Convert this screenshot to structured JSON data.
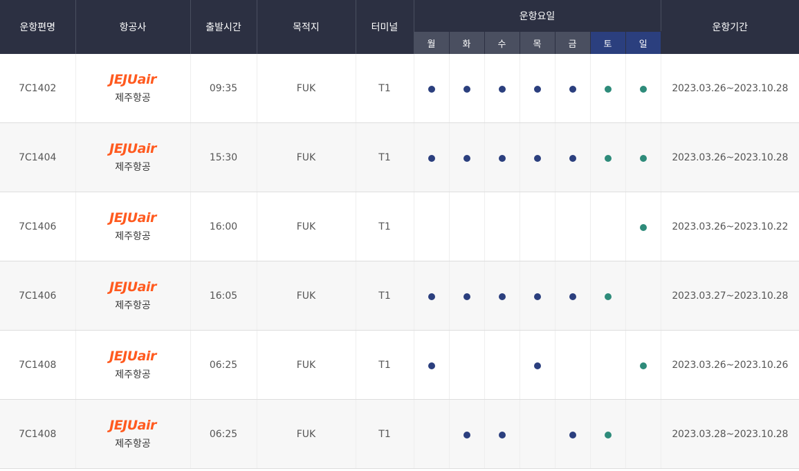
{
  "headers": {
    "flight_no": "운항편명",
    "airline": "항공사",
    "departure": "출발시간",
    "destination": "목적지",
    "terminal": "터미널",
    "days_group": "운항요일",
    "period": "운항기간"
  },
  "days": [
    "월",
    "화",
    "수",
    "목",
    "금",
    "토",
    "일"
  ],
  "colors": {
    "header_bg": "#2c3042",
    "weekday_header_bg": "#4a4f60",
    "weekend_header_bg": "#2b3f7e",
    "weekday_dot": "#2b3f7e",
    "weekend_dot": "#2e8b7a",
    "logo": "#ff5a1f"
  },
  "rows": [
    {
      "flight_no": "7C1402",
      "logo": "JEJUair",
      "airline": "제주항공",
      "time": "09:35",
      "dest": "FUK",
      "terminal": "T1",
      "days": [
        true,
        true,
        true,
        true,
        true,
        true,
        true
      ],
      "period": "2023.03.26~2023.10.28"
    },
    {
      "flight_no": "7C1404",
      "logo": "JEJUair",
      "airline": "제주항공",
      "time": "15:30",
      "dest": "FUK",
      "terminal": "T1",
      "days": [
        true,
        true,
        true,
        true,
        true,
        true,
        true
      ],
      "period": "2023.03.26~2023.10.28"
    },
    {
      "flight_no": "7C1406",
      "logo": "JEJUair",
      "airline": "제주항공",
      "time": "16:00",
      "dest": "FUK",
      "terminal": "T1",
      "days": [
        false,
        false,
        false,
        false,
        false,
        false,
        true
      ],
      "period": "2023.03.26~2023.10.22"
    },
    {
      "flight_no": "7C1406",
      "logo": "JEJUair",
      "airline": "제주항공",
      "time": "16:05",
      "dest": "FUK",
      "terminal": "T1",
      "days": [
        true,
        true,
        true,
        true,
        true,
        true,
        false
      ],
      "period": "2023.03.27~2023.10.28"
    },
    {
      "flight_no": "7C1408",
      "logo": "JEJUair",
      "airline": "제주항공",
      "time": "06:25",
      "dest": "FUK",
      "terminal": "T1",
      "days": [
        true,
        false,
        false,
        true,
        false,
        false,
        true
      ],
      "period": "2023.03.26~2023.10.26"
    },
    {
      "flight_no": "7C1408",
      "logo": "JEJUair",
      "airline": "제주항공",
      "time": "06:25",
      "dest": "FUK",
      "terminal": "T1",
      "days": [
        false,
        true,
        true,
        false,
        true,
        true,
        false
      ],
      "period": "2023.03.28~2023.10.28"
    }
  ]
}
